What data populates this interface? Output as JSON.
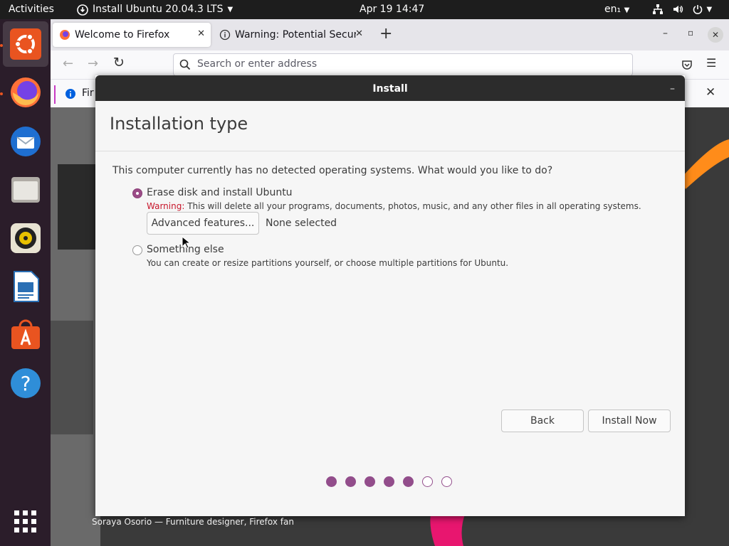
{
  "topbar": {
    "activities": "Activities",
    "app_name": "Install Ubuntu 20.04.3 LTS",
    "clock": "Apr 19  14:47",
    "lang": "en₁"
  },
  "dock": {
    "items": [
      "ubuntu-installer",
      "firefox",
      "thunderbird",
      "files",
      "rhythmbox",
      "libreoffice-writer",
      "software",
      "help",
      "show-apps"
    ]
  },
  "firefox": {
    "tabs": [
      {
        "label": "Welcome to Firefox"
      },
      {
        "label": "Warning: Potential Securi"
      }
    ],
    "url_placeholder": "Search or enter address",
    "infobar_text": "Fir",
    "caption": "Soraya Osorio — Furniture designer, Firefox fan"
  },
  "dialog": {
    "title": "Install",
    "heading": "Installation type",
    "question": "This computer currently has no detected operating systems. What would you like to do?",
    "options": [
      {
        "label": "Erase disk and install Ubuntu",
        "warning": "Warning:",
        "desc": " This will delete all your programs, documents, photos, music, and any other files in all operating systems.",
        "selected": true
      },
      {
        "label": "Something else",
        "desc": "You can create or resize partitions yourself, or choose multiple partitions for Ubuntu.",
        "selected": false
      }
    ],
    "advanced_button": "Advanced features...",
    "advanced_status": "None selected",
    "back_button": "Back",
    "install_button": "Install Now",
    "progress": {
      "total": 7,
      "completed": 5
    }
  },
  "colors": {
    "accent": "#924d8b",
    "orange": "#e95420",
    "warning": "#c7162b"
  }
}
